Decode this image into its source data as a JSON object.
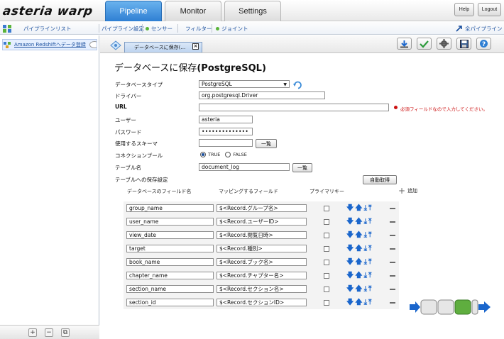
{
  "app": {
    "logo_text": "asteria warp",
    "main_tabs": [
      {
        "label": "Pipeline"
      },
      {
        "label": "Monitor"
      },
      {
        "label": "Settings"
      }
    ],
    "help_label": "Help",
    "logout_label": "Logout"
  },
  "subnav": {
    "pipeline_list": "パイプラインリスト",
    "pipeline_settings": "パイプライン設定",
    "sensor": "センサー",
    "filter": "フィルター",
    "joint": "ジョイント",
    "all_pipelines": "全パイプライン"
  },
  "tree": {
    "item_label": "Amazon Redshiftへデータ登録"
  },
  "editor": {
    "tab_label": "データベースに保存(…",
    "title_prefix": "データベースに保存",
    "title_suffix": "(PostgreSQL)",
    "db_type_label": "データベースタイプ",
    "db_type_value": "PostgreSQL",
    "driver_label": "ドライバー",
    "driver_value": "org.postgresql.Driver",
    "url_label": "URL",
    "url_value": "",
    "required_message": "必須フィールドなので入力してください。",
    "user_label": "ユーザー",
    "user_value": "asteria",
    "password_label": "パスワード",
    "password_value": "••••••••••••••",
    "schema_label": "使用するスキーマ",
    "schema_value": "",
    "list_button": "一覧",
    "pool_label": "コネクションプール",
    "pool_true": "TRUE",
    "pool_false": "FALSE",
    "pool_selected": "TRUE",
    "table_label": "テーブル名",
    "table_value": "document_log",
    "save_settings_label": "テーブルへの保存設定",
    "auto_fetch_button": "自動取得",
    "col_db_field": "データベースのフィールド名",
    "col_mapping": "マッピングするフィールド",
    "col_primary": "プライマリキー",
    "add_label": "追加"
  },
  "mapping_rows": [
    {
      "field": "group_name",
      "mapping": "$<Record.グループ名>",
      "primary": false
    },
    {
      "field": "user_name",
      "mapping": "$<Record.ユーザーID>",
      "primary": false
    },
    {
      "field": "view_date",
      "mapping": "$<Record.閲覧日時>",
      "primary": false
    },
    {
      "field": "target",
      "mapping": "$<Record.種別>",
      "primary": false
    },
    {
      "field": "book_name",
      "mapping": "$<Record.ブック名>",
      "primary": false
    },
    {
      "field": "chapter_name",
      "mapping": "$<Record.チャプター名>",
      "primary": false
    },
    {
      "field": "section_name",
      "mapping": "$<Record.セクション名>",
      "primary": false
    },
    {
      "field": "section_id",
      "mapping": "$<Record.セクションID>",
      "primary": false
    }
  ],
  "colors": {
    "active_tab": "#2f7fd3",
    "link": "#1a4f9e",
    "error": "#cc1111",
    "arrow_blue": "#1a66cc"
  }
}
